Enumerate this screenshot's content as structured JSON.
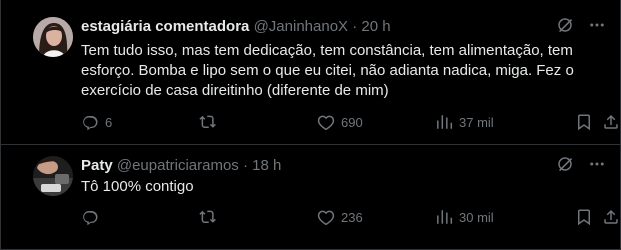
{
  "tweets": [
    {
      "author_name": "estagiária comentadora",
      "handle": "@JaninhanoX",
      "separator": "·",
      "time": "20 h",
      "text": "Tem tudo isso, mas tem dedicação, tem constância, tem alimentação, tem esforço. Bomba e lipo sem o que eu citei, não adianta nadica, miga. Fez o exercício de casa direitinho (diferente de mim)",
      "replies": "6",
      "retweets": "",
      "likes": "690",
      "views": "37 mil"
    },
    {
      "author_name": "Paty",
      "handle": "@eupatriciaramos",
      "separator": "·",
      "time": "18 h",
      "text": "Tô 100% contigo",
      "replies": "",
      "retweets": "",
      "likes": "236",
      "views": "30 mil"
    }
  ],
  "icons": {
    "header_left": "grok-icon",
    "header_right": "more-icon",
    "reply": "reply-icon",
    "retweet": "retweet-icon",
    "like": "heart-icon",
    "views": "views-icon",
    "bookmark": "bookmark-icon",
    "share": "share-icon"
  },
  "colors": {
    "background": "#000000",
    "text": "#e7e9ea",
    "secondary": "#71767b",
    "border": "#2f3336"
  }
}
